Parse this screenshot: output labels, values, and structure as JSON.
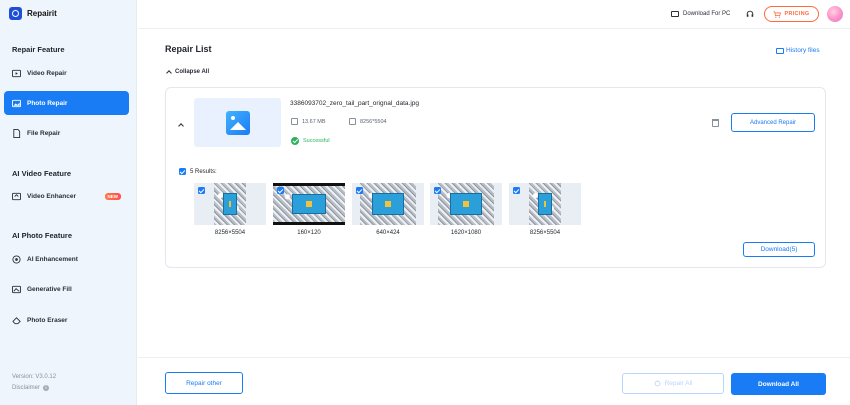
{
  "app": {
    "name": "Repairit"
  },
  "sidebar": {
    "sections": [
      {
        "title": "Repair Feature"
      },
      {
        "title": "AI Video Feature"
      },
      {
        "title": "AI Photo Feature"
      }
    ],
    "items": [
      {
        "label": "Video Repair",
        "icon": "video-icon"
      },
      {
        "label": "Photo Repair",
        "icon": "photo-icon",
        "active": true
      },
      {
        "label": "File Repair",
        "icon": "file-icon"
      },
      {
        "label": "Video Enhancer",
        "icon": "video-enhancer-icon",
        "badge": "NEW"
      },
      {
        "label": "AI Enhancement",
        "icon": "ai-enhancement-icon"
      },
      {
        "label": "Generative Fill",
        "icon": "generative-fill-icon"
      },
      {
        "label": "Photo Eraser",
        "icon": "eraser-icon"
      }
    ],
    "version": "Version: V3.0.12",
    "disclaimer": "Disclaimer"
  },
  "topbar": {
    "download_pc": "Download For PC",
    "pricing": "PRICING"
  },
  "main": {
    "title": "Repair List",
    "history": "History files",
    "collapse": "Collapse All",
    "file": {
      "name": "3386093702_zero_tail_part_orignal_data.jpg",
      "size": "13.67 MB",
      "dimensions": "8256*5504",
      "status": "Successful",
      "advanced_repair": "Advanced Repair"
    },
    "results_label": "5 Results:",
    "results": [
      {
        "label": "8256×5504"
      },
      {
        "label": "160×120"
      },
      {
        "label": "640×424"
      },
      {
        "label": "1620×1080"
      },
      {
        "label": "8256×5504"
      }
    ],
    "download_results": "Download(5)"
  },
  "footer": {
    "repair_other": "Repair other",
    "repair_all": "Repair All",
    "download_all": "Download All"
  },
  "colors": {
    "accent": "#1a7cf5",
    "pricing": "#ff6a3d",
    "success": "#2bb15a"
  }
}
